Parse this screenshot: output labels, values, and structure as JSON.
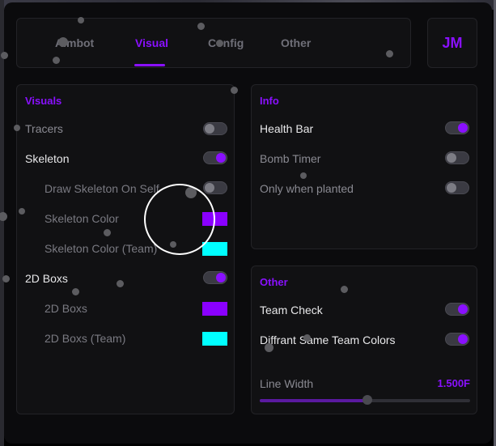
{
  "tabs": {
    "items": [
      {
        "label": "Aimbot"
      },
      {
        "label": "Visual"
      },
      {
        "label": "Config"
      },
      {
        "label": "Other"
      }
    ],
    "active": "Visual"
  },
  "avatar": {
    "initials": "JM"
  },
  "visuals": {
    "title": "Visuals",
    "tracers": {
      "label": "Tracers",
      "enabled": false
    },
    "skeleton": {
      "label": "Skeleton",
      "enabled": true
    },
    "draw_skeleton_on_self": {
      "label": "Draw Skeleton On Self",
      "enabled": false
    },
    "skeleton_color": {
      "label": "Skeleton Color",
      "color": "#8a00ff"
    },
    "skeleton_color_team": {
      "label": "Skeleton Color (Team)",
      "color": "#00ffff"
    },
    "boxes_2d": {
      "label": "2D Boxs",
      "enabled": true
    },
    "boxes_2d_color": {
      "label": "2D Boxs",
      "color": "#8a00ff"
    },
    "boxes_2d_team": {
      "label": "2D Boxs (Team)",
      "color": "#00ffff"
    }
  },
  "info": {
    "title": "Info",
    "health_bar": {
      "label": "Health Bar",
      "enabled": true
    },
    "bomb_timer": {
      "label": "Bomb Timer",
      "enabled": false
    },
    "only_when_planted": {
      "label": "Only when planted",
      "enabled": false
    }
  },
  "other": {
    "title": "Other",
    "team_check": {
      "label": "Team Check",
      "enabled": true
    },
    "diffrant_same_team_colors": {
      "label": "Diffrant Same Team Colors",
      "enabled": true
    },
    "line_width": {
      "label": "Line Width",
      "value_text": "1.500F",
      "fraction": 0.51
    }
  },
  "colors": {
    "accent": "#8a10ff",
    "cyan": "#00ffff",
    "panel": "#111113"
  }
}
